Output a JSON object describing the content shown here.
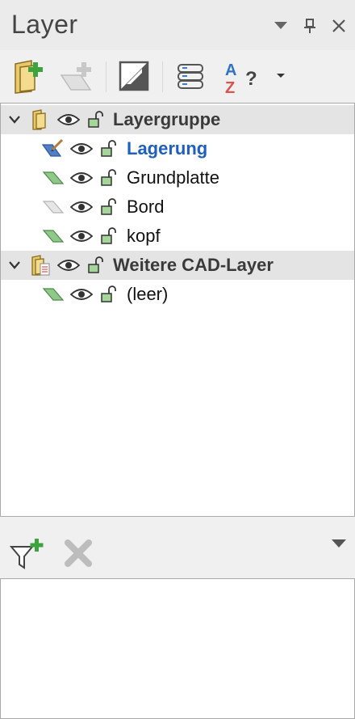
{
  "panel": {
    "title": "Layer"
  },
  "toolbar": {
    "buttons": [
      {
        "name": "new-layer-group",
        "icon": "folder-plus-icon"
      },
      {
        "name": "new-layer",
        "icon": "layer-plus-icon"
      },
      {
        "name": "layer-properties",
        "icon": "contrast-icon"
      },
      {
        "name": "layer-list",
        "icon": "database-icon"
      },
      {
        "name": "sort",
        "icon": "sort-az-help-icon",
        "sort_text": "A\nZ",
        "help_text": "?"
      }
    ]
  },
  "tree": {
    "rows": [
      {
        "type": "group",
        "label": "Layergruppe",
        "expanded": true,
        "icon": "folder-icon"
      },
      {
        "type": "layer",
        "label": "Lagerung",
        "active": true,
        "icon": "layer-edit-icon"
      },
      {
        "type": "layer",
        "label": "Grundplatte",
        "icon": "layer-green-icon"
      },
      {
        "type": "layer",
        "label": "Bord",
        "icon": "layer-empty-icon"
      },
      {
        "type": "layer",
        "label": "kopf",
        "icon": "layer-green-icon"
      },
      {
        "type": "group",
        "label": "Weitere CAD-Layer",
        "expanded": true,
        "icon": "folder-doc-icon"
      },
      {
        "type": "layer",
        "label": "(leer)",
        "icon": "layer-green-icon"
      }
    ]
  },
  "colors": {
    "accent": "#1e5fbf",
    "layer_green": "#8fc98a",
    "lock_green": "#5fa14f",
    "folder": "#e8c86a"
  }
}
